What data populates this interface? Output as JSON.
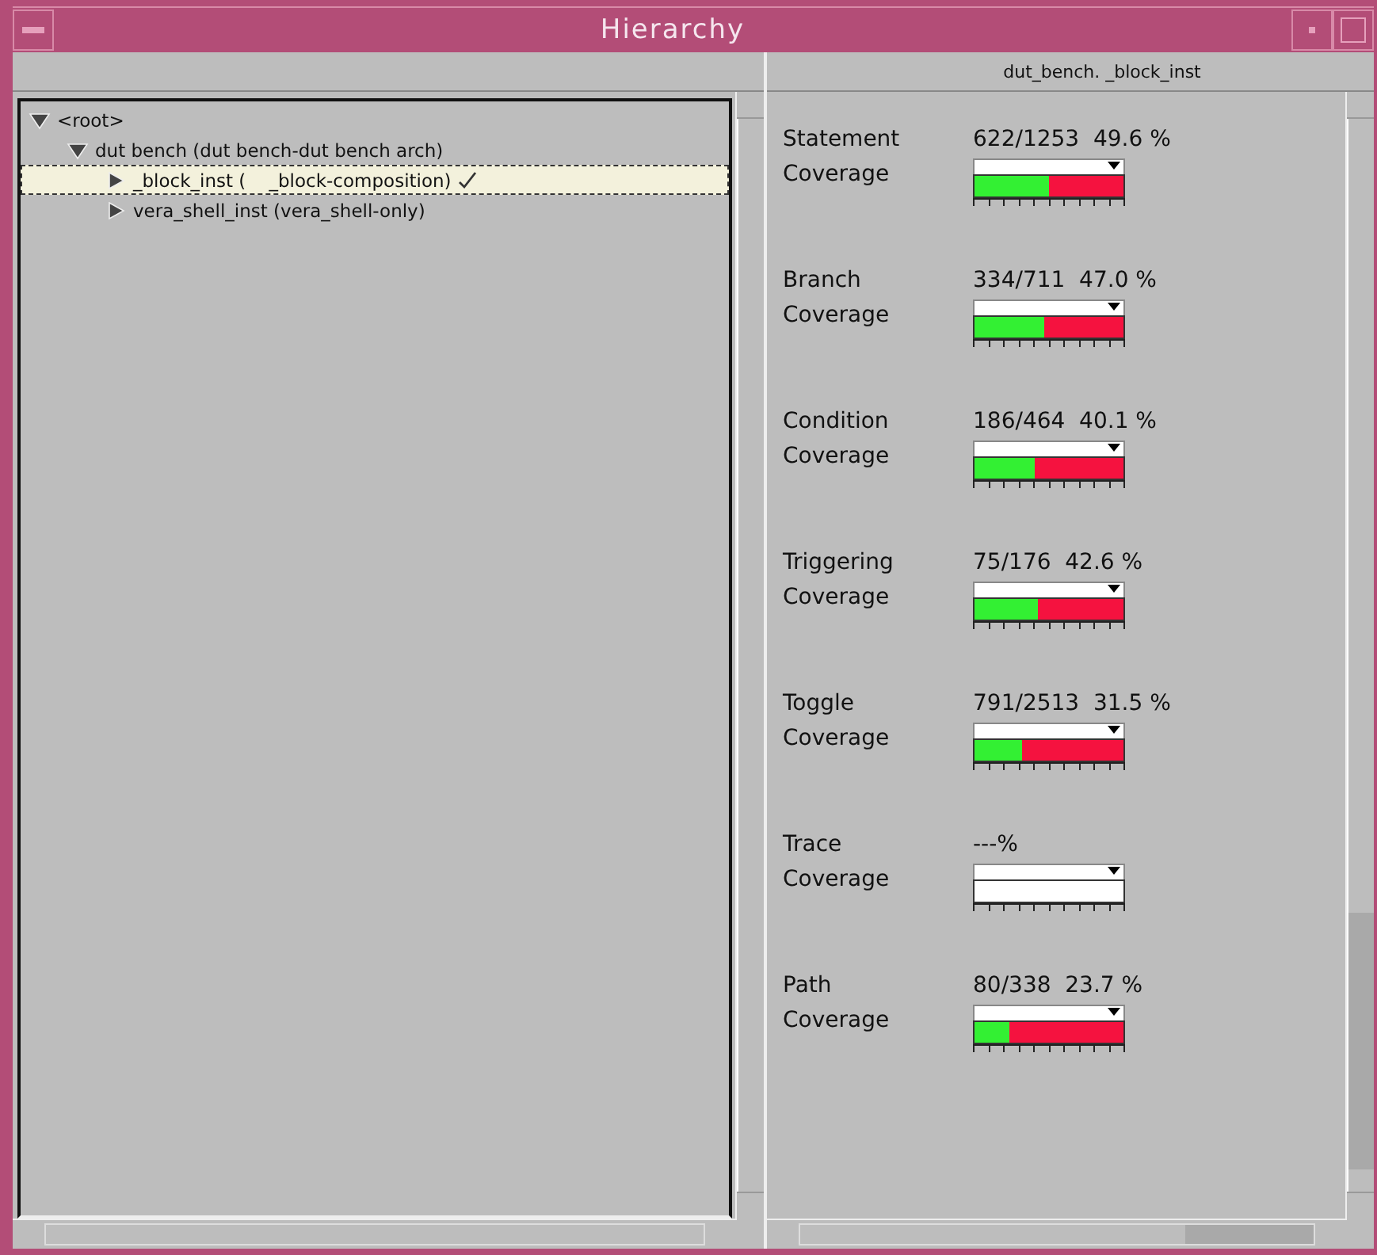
{
  "window": {
    "title": "Hierarchy"
  },
  "tree": [
    {
      "label": "<root>",
      "expanded": true,
      "selected": false,
      "children": [
        {
          "label": "dut bench (dut bench-dut bench arch)",
          "expanded": true,
          "selected": false,
          "children": [
            {
              "label": "_block_inst (    _block-composition)",
              "expanded": false,
              "selected": true,
              "checked": true
            },
            {
              "label": "vera_shell_inst (vera_shell-only)",
              "expanded": false,
              "selected": false,
              "checked": false
            }
          ]
        }
      ]
    }
  ],
  "details": {
    "path": "dut_bench.    _block_inst",
    "metrics": [
      {
        "name": "Statement",
        "label": "Coverage",
        "value": "622/1253  49.6 %",
        "level": 0.496
      },
      {
        "name": "Branch",
        "label": "Coverage",
        "value": "334/711  47.0 %",
        "level": 0.47
      },
      {
        "name": "Condition",
        "label": "Coverage",
        "value": "186/464  40.1 %",
        "level": 0.401
      },
      {
        "name": "Triggering",
        "label": "Coverage",
        "value": "75/176  42.6 %",
        "level": 0.426
      },
      {
        "name": "Toggle",
        "label": "Coverage",
        "value": "791/2513  31.5 %",
        "level": 0.315
      },
      {
        "name": "Trace",
        "label": "Coverage",
        "value": "---%"
      },
      {
        "name": "Path",
        "label": "Coverage",
        "value": "80/338  23.7 %",
        "level": 0.237
      }
    ]
  }
}
